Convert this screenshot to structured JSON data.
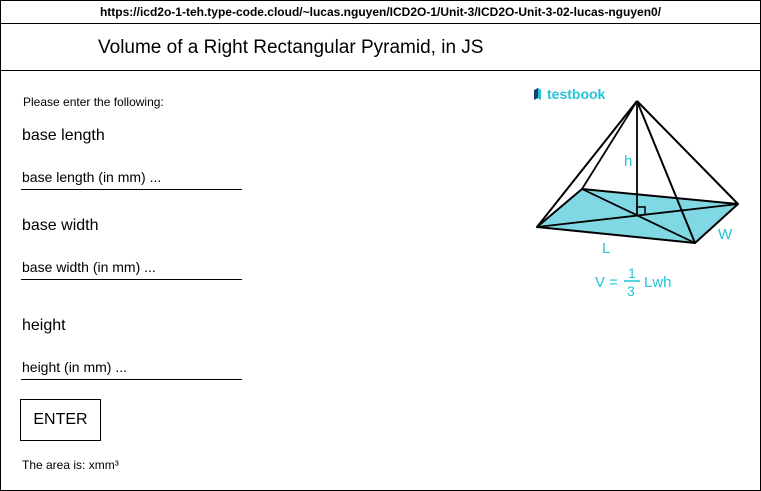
{
  "browser": {
    "url": "https://icd2o-1-teh.type-code.cloud/~lucas.nguyen/ICD2O-1/Unit-3/ICD2O-Unit-3-02-lucas-nguyen0/"
  },
  "header": {
    "title": "Volume of a Right Rectangular Pyramid, in JS"
  },
  "form": {
    "prompt": "Please enter the following:",
    "base_length": {
      "label": "base length",
      "placeholder": "base length (in mm) ..."
    },
    "base_width": {
      "label": "base width",
      "placeholder": "base width (in mm) ..."
    },
    "height": {
      "label": "height",
      "placeholder": "height (in mm) ..."
    },
    "enter_label": "ENTER",
    "result": "The area is: xmm³"
  },
  "figure": {
    "logo_text": "testbook",
    "label_h": "h",
    "label_l": "L",
    "label_w": "W",
    "formula_prefix": "V =",
    "formula_num": "1",
    "formula_den": "3",
    "formula_suffix": "Lwh",
    "accent_color": "#21c4d8",
    "base_fill": "#7fd8e3"
  }
}
